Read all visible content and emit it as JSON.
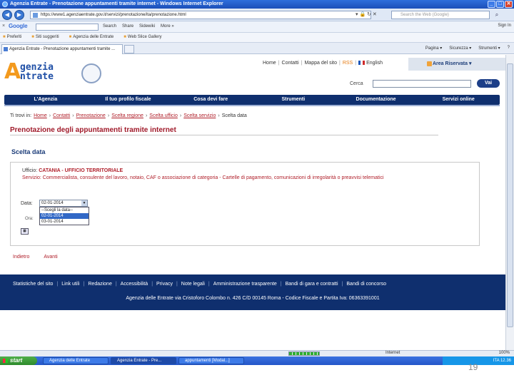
{
  "window": {
    "title": "Agenzia Entrate - Prenotazione appuntamenti tramite internet - Windows Internet Explorer",
    "buttons": [
      "_",
      "□",
      "✕"
    ]
  },
  "address_bar": {
    "url": "https://www1.agenziaentrate.gov.it/servizi/prenotazione/ita/prenotazione.html",
    "search_placeholder": "Search the Web (Google)",
    "search_icon": "magnifier-icon"
  },
  "google_toolbar": {
    "logo": "Google",
    "items": [
      "Search",
      "Share",
      "Sidewiki",
      "More »"
    ],
    "right": [
      "Sign In"
    ]
  },
  "favorites_bar": {
    "items": [
      "Preferiti",
      "Siti suggeriti",
      "Agenzia delle Entrate",
      "Web Slice Gallery"
    ]
  },
  "tab": {
    "label": "Agenzia Entrate - Prenotazione appuntamenti tramite ...",
    "commands": [
      "Pagina ▾",
      "Sicurezza ▾",
      "Strumenti ▾",
      "?"
    ]
  },
  "site": {
    "logo_line1": "genzia",
    "logo_line2": "ntrate",
    "logo_letter": "A",
    "top_links": [
      "Home",
      "Contatti",
      "Mappa del sito",
      "RSS",
      "English"
    ],
    "area_riservata": "Area Riservata ▾",
    "search_label": "Cerca",
    "search_button": "Vai",
    "nav": [
      "L'Agenzia",
      "Il tuo profilo fiscale",
      "Cosa devi fare",
      "Strumenti",
      "Documentazione",
      "Servizi online"
    ],
    "breadcrumb_prefix": "Ti trovi in:",
    "breadcrumb": [
      "Home",
      "Contatti",
      "Prenotazione",
      "Scelta regione",
      "Scelta ufficio",
      "Scelta servizio"
    ],
    "breadcrumb_current": "Scelta data",
    "page_title": "Prenotazione degli appuntamenti tramite internet",
    "section_title": "Scelta data",
    "ufficio_label": "Ufficio:",
    "ufficio_value": "CATANIA - UFFICIO TERRITORIALE",
    "servizio_text": "Servizio: Commercialista, consulente del lavoro, notaio, CAF o associazione di categoria - Cartelle di pagamento, comunicazioni di irregolarità o preavvisi telematici",
    "date_label": "Data:",
    "date_selected": "02-01-2014",
    "date_options": [
      "--Scegli la data--",
      "02-01-2014",
      "03-01-2014"
    ],
    "date_options_selected_index": 1,
    "ora_label": "Ora:",
    "bottom_links": [
      "Indietro",
      "Avanti"
    ],
    "footer_links": [
      "Statistiche del sito",
      "Link utili",
      "Redazione",
      "Accessibilità",
      "Privacy",
      "Note legali",
      "Amministrazione trasparente",
      "Bandi di gara e contratti",
      "Bandi di concorso"
    ],
    "footer_address": "Agenzia delle Entrate via Cristoforo Colombo n. 426 C/D 00145 Roma - Codice Fiscale e Partita Iva: 06363391001"
  },
  "status_bar": {
    "zone": "Internet",
    "zoom": "100%"
  },
  "taskbar": {
    "start": "start",
    "tasks": [
      "Agenzia delle Entrate",
      "Agenzia Entrate - Pre...",
      "appuntamenti [Modal...]"
    ],
    "tray": "ITA 12.36"
  },
  "slide_number": "19"
}
